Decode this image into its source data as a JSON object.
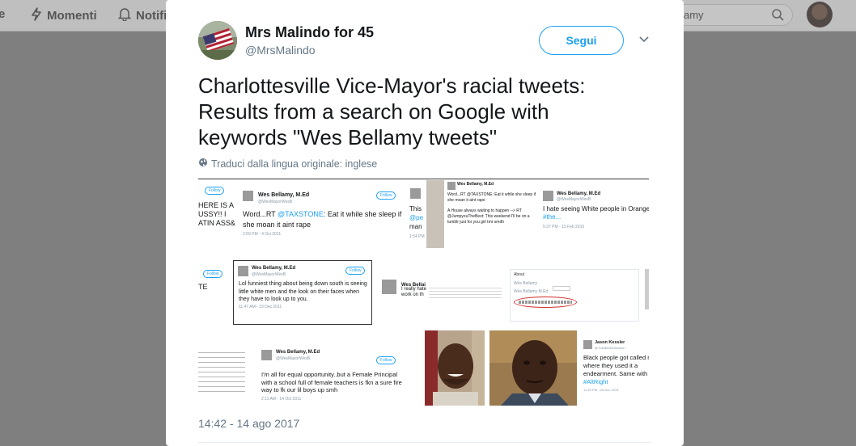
{
  "nav": {
    "home_label": "e",
    "moments_label": "Momenti",
    "notifications_label": "Notifi",
    "search_value": "amy"
  },
  "tweet": {
    "author_name": "Mrs Malindo for 45",
    "author_handle": "@MrsMalindo",
    "follow_label": "Segui",
    "text_line1": "Charlottesville Vice-Mayor's racial tweets:",
    "text_line2": "Results from a search on Google with",
    "text_line3": "keywords \"Wes Bellamy tweets\"",
    "translate_label": "Traduci dalla lingua originale: inglese",
    "timestamp": "14:42 - 14 ago 2017"
  },
  "media": {
    "s1": {
      "lines": [
        "HERE IS A",
        "USSY!! I",
        "ATIN ASS&"
      ],
      "follow": "Follow"
    },
    "s2": {
      "name": "Wes Bellamy, M.Ed",
      "handle": "@WesMayorWesB",
      "follow": "Follow",
      "text_pre": "Word...RT ",
      "text_link": "@TAXSTONE",
      "text_post": ": Eat it while she sleep if she moan it aint rape",
      "footer": "2:59 PM - 4 Oct 2011"
    },
    "s3": {
      "lines": [
        "This",
        "@pe",
        "man"
      ],
      "footer": "1:54 PM"
    },
    "s4": {
      "name": "Wes Bellamy, M.Ed",
      "line1": "Word...RT @TAXSTONE: Eat it while she sleep if",
      "line2": "she moan it aint rape",
      "line3": "A House always waiting to happen --> RT",
      "line4": "@JumpyouTheBest: This weekend I'll be on a",
      "line5": "tumblr just for you girl tmr smdh"
    },
    "s5": {
      "name": "Wes Bellamy, M.Ed",
      "handle": "@WesMayorWesB",
      "text": "I hate seeing White people in Orange",
      "link": "#the...",
      "footer": "5:37 PM - 13 Feb 2015"
    },
    "s6": {
      "follow": "Follow",
      "label": "TE"
    },
    "s7": {
      "name": "Wes Bellamy, M.Ed",
      "handle": "@WesMayorWesB",
      "follow": "Follow",
      "text": "Lol funniest thing about being down south is seeing little white men and the look on their faces when they have to look up to you.",
      "footer": "11:47 AM - 19 Dec 2011"
    },
    "s8": {
      "name": "Wes Bellai",
      "line1": "I really hate",
      "line2": "work on th"
    },
    "s9": {
      "title": "About",
      "section1": "Wes Bellamy",
      "section2": "Wes Bellamy M.Ed"
    },
    "s11": {
      "name": "Wes Bellamy, M.Ed",
      "handle": "@WesMayorWesB",
      "follow": "Follow",
      "text": "I'm all for equal opportunity..but a Female Principal with a school full of female teachers is fkn a sure fire way to fk our lil boys up smh",
      "footer": "2:11 AM - 14 Oct 2011"
    },
    "s14": {
      "name": "Jason Kessler",
      "handle": "@TheMadDimension",
      "line1": "Black people got called n",
      "line2": "where they used it a",
      "line3": "endearment. Same with w",
      "link": "#AltRight",
      "footer": "12:29 PM - 28 Nov 2016"
    }
  }
}
